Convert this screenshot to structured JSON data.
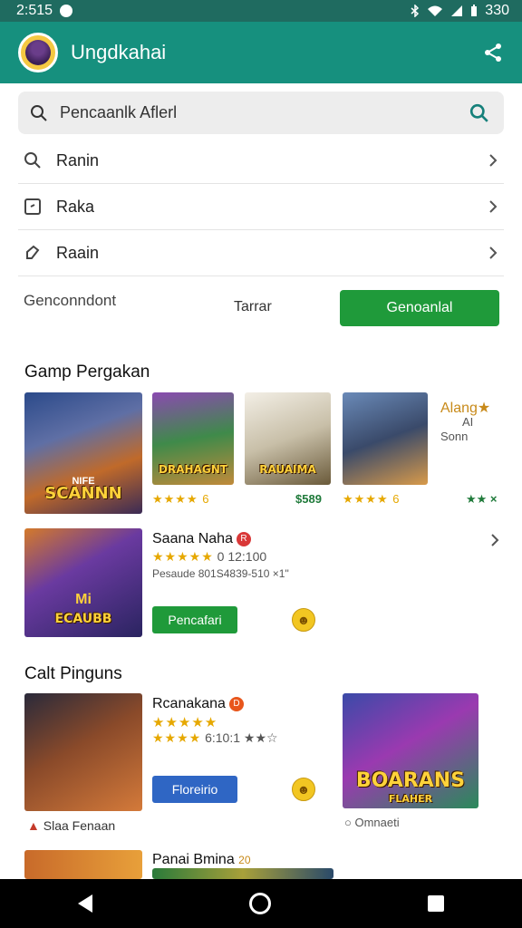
{
  "status": {
    "time": "2:515",
    "battery": "330"
  },
  "app": {
    "title": "Ungdkahai"
  },
  "search": {
    "text": "Pencaanlk Aflerl"
  },
  "menu": [
    {
      "label": "Ranin"
    },
    {
      "label": "Raka"
    },
    {
      "label": "Raain"
    }
  ],
  "actions": {
    "left": "Genconndont",
    "mid": "Tarrar",
    "button": "Genoanlal"
  },
  "section1": {
    "title": "Gamp Pergakan",
    "thumb1_title": "SCANNN",
    "thumb1_sub": "NIFE",
    "thumb2_title": "DRAHAGNT",
    "thumb3_title": "RAUAIMA",
    "card1_rating": "★★★★ 6",
    "card3_rating": "$589",
    "card4_rating": "★★★★ 6",
    "side_title": "Alang★",
    "side_sub": "AI",
    "side_sub2": "Sonn",
    "side_rating": "★★ ×",
    "featured": {
      "title": "Saana Naha",
      "badge": "R",
      "stars": "★★★★★",
      "rating_line": "0 12:100",
      "meta": "Pesaude 801S4839-510 ×1\"",
      "button": "Pencafari",
      "emoji": "☻",
      "thumb_title": "ECAUBB",
      "thumb_sub": "Mi"
    }
  },
  "section2": {
    "title": "Calt Pinguns",
    "item1": {
      "title": "Rcanakana",
      "badge": "D",
      "stars1": "★★★★★",
      "stars2": "★★★★",
      "rating_line": "6:10:1 ★★☆",
      "button": "Floreirio",
      "emoji": "☻",
      "caption": "Slaa Fenaan"
    },
    "item2": {
      "title": "BOARANS",
      "subtitle": "FLAHER",
      "caption": "Omnaeti"
    },
    "item3": {
      "title": "Panai Bmina",
      "badge": "20"
    }
  },
  "colors": {
    "app_bar": "#16907e",
    "status_bar": "#1f6b60",
    "primary_button": "#1f9a3a",
    "secondary_button": "#2f66c4"
  }
}
